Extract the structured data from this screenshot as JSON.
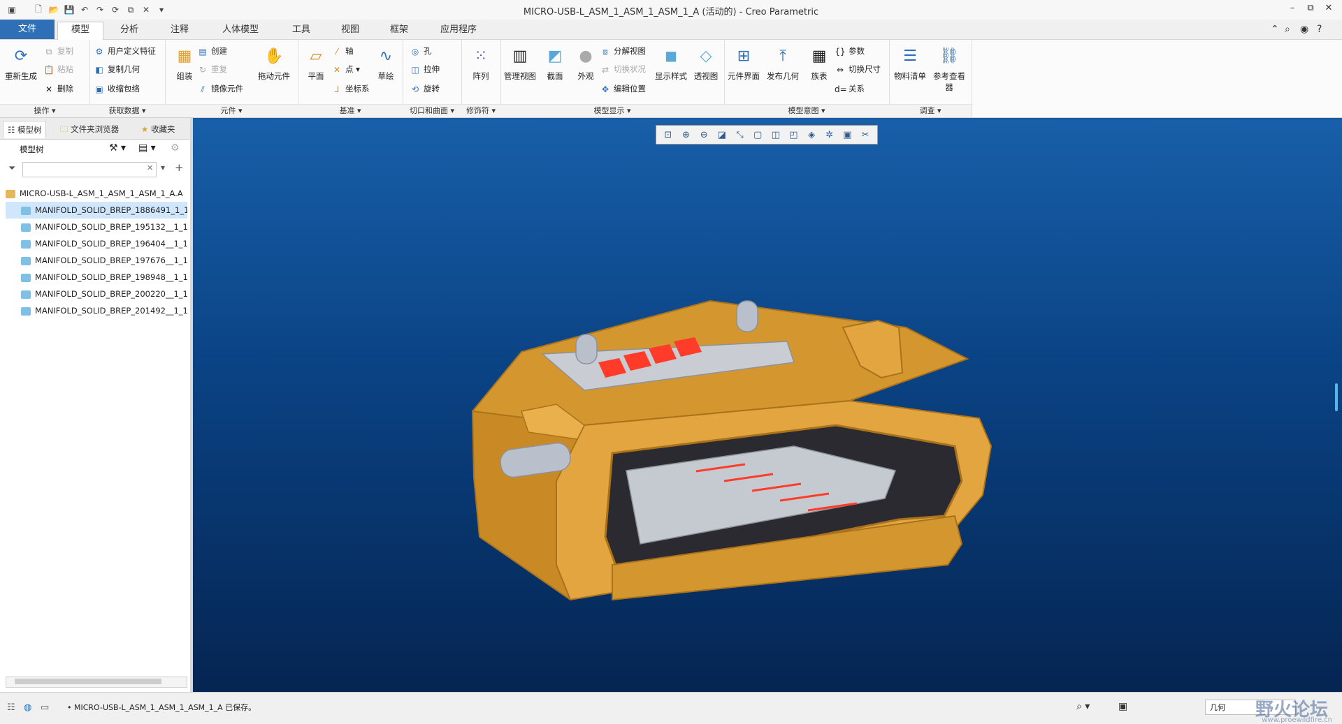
{
  "window": {
    "title": "MICRO-USB-L_ASM_1_ASM_1_ASM_1_A (活动的) - Creo Parametric",
    "controls": [
      "–",
      "⧉",
      "✕"
    ]
  },
  "tabs": [
    {
      "label": "文件"
    },
    {
      "label": "模型"
    },
    {
      "label": "分析"
    },
    {
      "label": "注释"
    },
    {
      "label": "人体模型"
    },
    {
      "label": "工具"
    },
    {
      "label": "视图"
    },
    {
      "label": "框架"
    },
    {
      "label": "应用程序"
    }
  ],
  "ribbon": {
    "operations": {
      "regen": "重新生成",
      "copy": "复制",
      "paste": "粘贴",
      "delete": "删除",
      "group": "操作"
    },
    "getdata": {
      "udf": "用户定义特征",
      "copygeom": "复制几何",
      "shrinkwrap": "收缩包络",
      "group": "获取数据"
    },
    "component": {
      "assemble": "组装",
      "create": "创建",
      "repeat": "重复",
      "mirror": "镜像元件",
      "drag": "拖动元件",
      "group": "元件"
    },
    "datum": {
      "plane": "平面",
      "axis": "轴",
      "point": "点",
      "csys": "坐标系",
      "sketch": "草绘",
      "group": "基准"
    },
    "cut": {
      "hole": "孔",
      "extrude": "拉伸",
      "revolve": "旋转",
      "group": "切口和曲面"
    },
    "modifiers": {
      "pattern": "阵列",
      "group": "修饰符"
    },
    "display": {
      "manageview": "管理视图",
      "section": "截面",
      "appearance": "外观",
      "explode": "分解视图",
      "togglestate": "切换状况",
      "editpos": "编辑位置",
      "displaystyle": "显示样式",
      "perspective": "透视图",
      "group": "模型显示"
    },
    "intent": {
      "interface": "元件界面",
      "publish": "发布几何",
      "family": "族表",
      "params": "参数",
      "toggledim": "切换尺寸",
      "relations": "关系",
      "group": "模型意图"
    },
    "investigate": {
      "bom": "物料清单",
      "refviewer": "参考查看器",
      "group": "调查"
    }
  },
  "leftpanel": {
    "tabs": [
      "模型树",
      "文件夹浏览器",
      "收藏夹"
    ],
    "header": "模型树",
    "tree": [
      "MICRO-USB-L_ASM_1_ASM_1_ASM_1_A.A",
      "MANIFOLD_SOLID_BREP_1886491_1_1",
      "MANIFOLD_SOLID_BREP_195132__1_1",
      "MANIFOLD_SOLID_BREP_196404__1_1",
      "MANIFOLD_SOLID_BREP_197676__1_1",
      "MANIFOLD_SOLID_BREP_198948__1_1",
      "MANIFOLD_SOLID_BREP_200220__1_1",
      "MANIFOLD_SOLID_BREP_201492__1_1"
    ]
  },
  "status": {
    "message": "MICRO-USB-L_ASM_1_ASM_1_ASM_1_A 已保存。",
    "filter": "几何",
    "watermark": "野火论坛",
    "watermark_url": "www.proewildfire.cn"
  },
  "colors": {
    "accent": "#2e6fb5",
    "housing": "#e0a13a",
    "contacts": "#ff3b2a",
    "metal": "#b9c0cc"
  }
}
